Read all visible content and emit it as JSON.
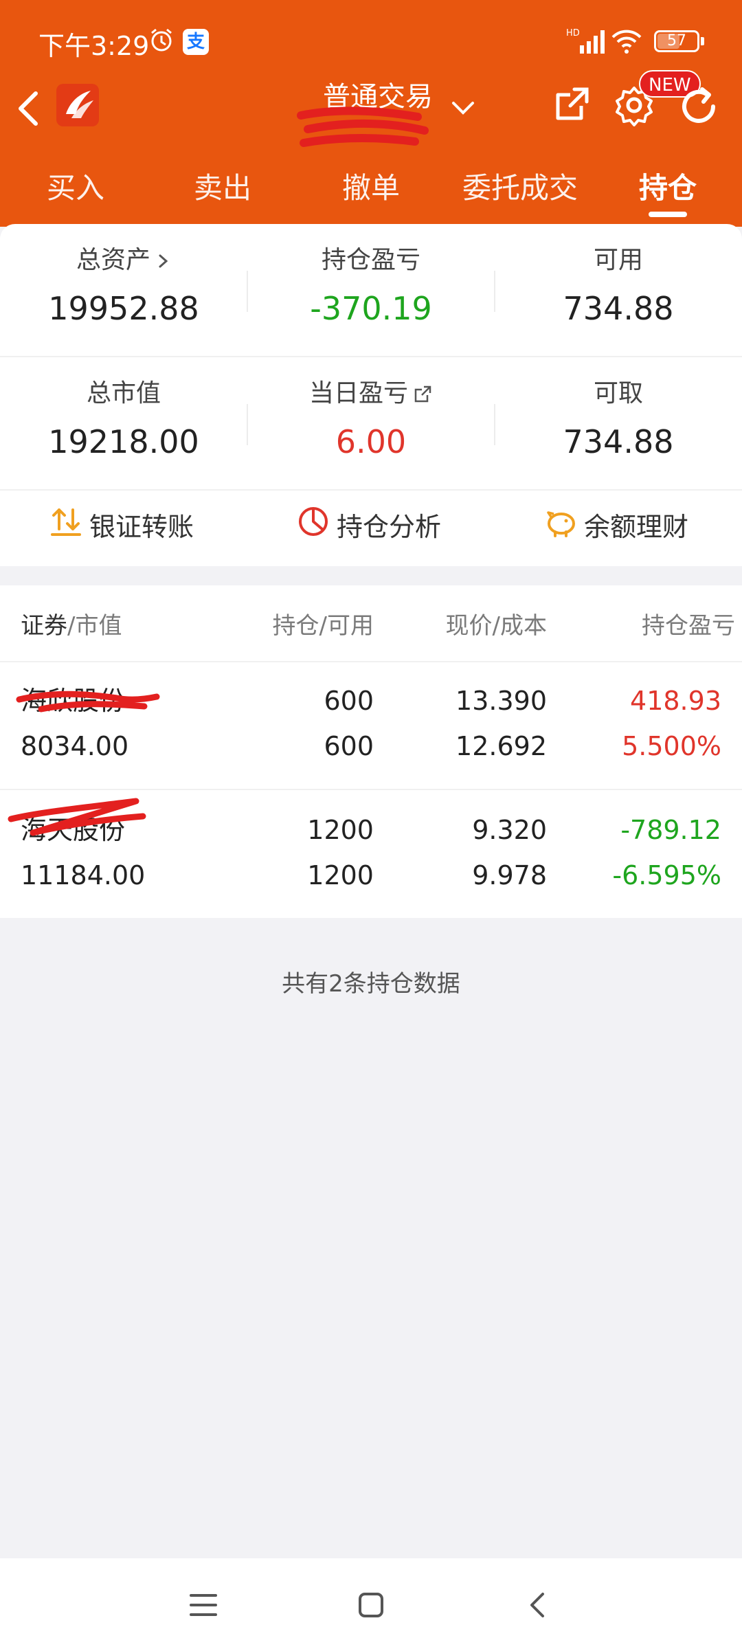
{
  "status_bar": {
    "time": "下午3:29",
    "battery": "57",
    "battery_level_percent": 57
  },
  "nav": {
    "title": "普通交易",
    "new_badge": "NEW"
  },
  "tabs": [
    {
      "label": "买入"
    },
    {
      "label": "卖出"
    },
    {
      "label": "撤单"
    },
    {
      "label": "委托成交"
    },
    {
      "label": "持仓"
    }
  ],
  "summary": {
    "total_assets_label": "总资产",
    "total_assets": "19952.88",
    "position_pnl_label": "持仓盈亏",
    "position_pnl": "-370.19",
    "available_label": "可用",
    "available": "734.88",
    "market_value_label": "总市值",
    "market_value": "19218.00",
    "daily_pnl_label": "当日盈亏",
    "daily_pnl": "6.00",
    "withdrawable_label": "可取",
    "withdrawable": "734.88"
  },
  "quick_actions": [
    {
      "label": "银证转账",
      "icon": "transfer-icon"
    },
    {
      "label": "持仓分析",
      "icon": "pie-chart-icon"
    },
    {
      "label": "余额理财",
      "icon": "piggy-bank-icon"
    }
  ],
  "table": {
    "col1_a": "证券",
    "col1_b": "/市值",
    "col2": "持仓/可用",
    "col3": "现价/成本",
    "col4": "持仓盈亏",
    "rows": [
      {
        "name": "海欣股份",
        "market_value": "8034.00",
        "position": "600",
        "available": "600",
        "price": "13.390",
        "cost": "12.692",
        "pnl": "418.93",
        "pnl_pct": "5.500%"
      },
      {
        "name": "海天股份",
        "market_value": "11184.00",
        "position": "1200",
        "available": "1200",
        "price": "9.320",
        "cost": "9.978",
        "pnl": "-789.12",
        "pnl_pct": "-6.595%"
      }
    ]
  },
  "footer_note": "共有2条持仓数据",
  "colors": {
    "header": "#e8560f",
    "positive": "#e0352b",
    "negative": "#1ea51e"
  }
}
